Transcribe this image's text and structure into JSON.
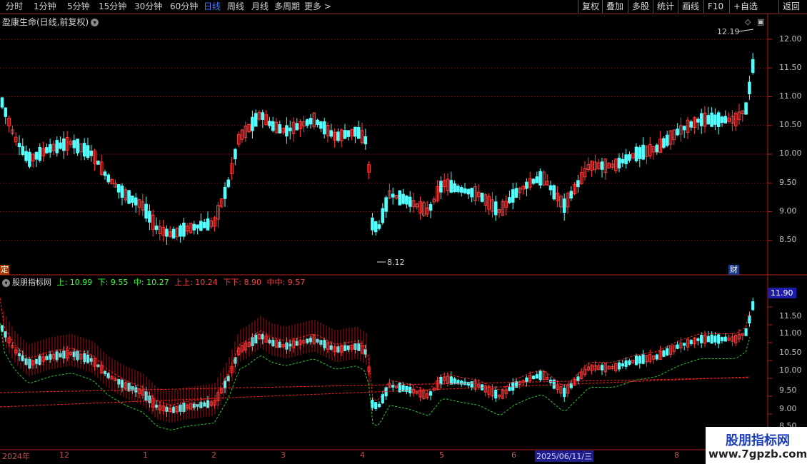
{
  "toolbar": {
    "periods": [
      "分时",
      "1分钟",
      "5分钟",
      "15分钟",
      "30分钟",
      "60分钟",
      "日线",
      "周线",
      "月线",
      "多周期",
      "更多 >"
    ],
    "active_period": "日线",
    "buttons": [
      "复权",
      "叠加",
      "多股",
      "统计",
      "画线",
      "F10",
      "+自选",
      "返回"
    ]
  },
  "main_chart": {
    "title": "盈康生命(日线,前复权)",
    "high_label": "12.19",
    "low_label": "8.12",
    "y_ticks": [
      "12.00",
      "11.50",
      "11.00",
      "10.50",
      "10.00",
      "9.50",
      "9.00",
      "8.50"
    ],
    "left_badge": "定",
    "right_badge": "财"
  },
  "indicator": {
    "name": "股朋指标网",
    "values": [
      {
        "label": "上: 10.99",
        "color": "#3cff3c"
      },
      {
        "label": "下: 9.55",
        "color": "#3cff3c"
      },
      {
        "label": "中: 10.27",
        "color": "#3cff3c"
      },
      {
        "label": "上上: 10.24",
        "color": "#ff4040"
      },
      {
        "label": "下下: 8.90",
        "color": "#ff4040"
      },
      {
        "label": "中中: 9.57",
        "color": "#ff4040"
      }
    ],
    "current_value": "11.90",
    "y_ticks": [
      "11.50",
      "11.00",
      "10.50",
      "10.00",
      "9.50",
      "9.00",
      "8.50"
    ]
  },
  "x_axis": {
    "labels": [
      "2024年",
      "12",
      "1",
      "2",
      "3",
      "4",
      "5",
      "6",
      "8"
    ],
    "cursor_date": "2025/06/11/三"
  },
  "watermark": {
    "line1": "股朋指标网",
    "line2": "www.7gpzb.com"
  },
  "colors": {
    "up": "#ff3b3b",
    "down": "#54ffff",
    "grid": "#7a1a1a",
    "band": "#ff2020",
    "ma_green": "#2fc82f"
  }
}
